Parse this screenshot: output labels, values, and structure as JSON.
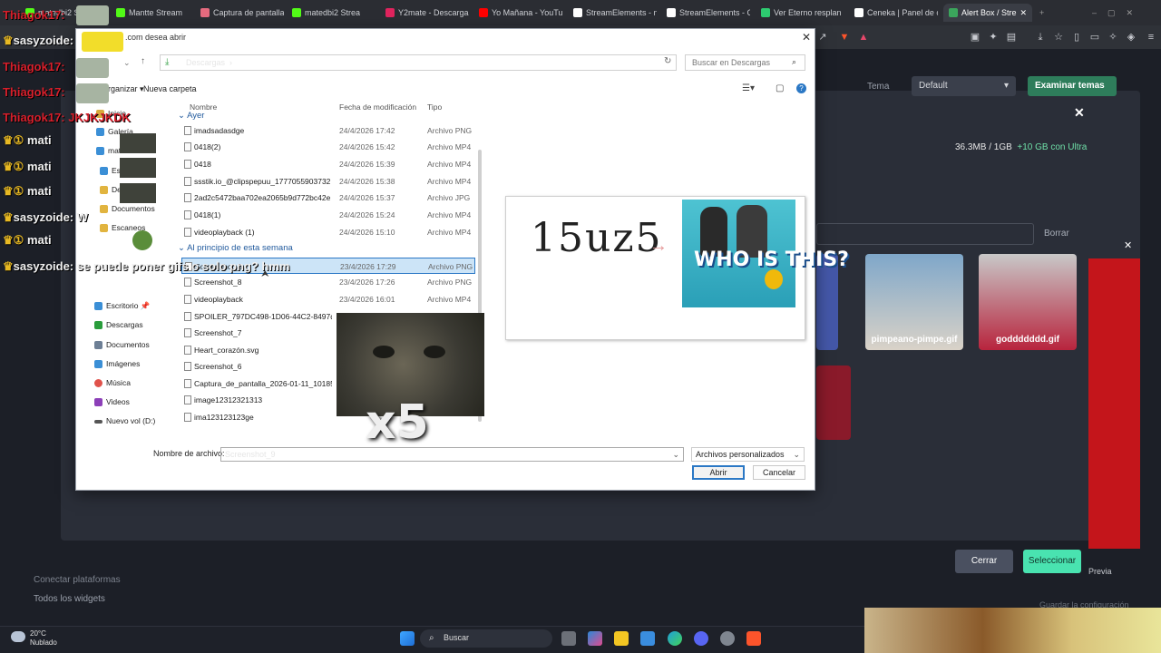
{
  "browser": {
    "tabs": [
      {
        "label": "matedbi2 Stream",
        "icon": "kick-icon",
        "color": "#53fc18"
      },
      {
        "label": "Mantte Stream",
        "icon": "kick-icon",
        "color": "#53fc18"
      },
      {
        "label": "Captura de pantalla",
        "icon": "folder-icon",
        "color": "#e66b7f"
      },
      {
        "label": "matedbi2 Strea",
        "icon": "kick-icon",
        "color": "#53fc18"
      },
      {
        "label": "Y2mate - Descarga",
        "icon": "y2mate-icon",
        "color": "#e0245e"
      },
      {
        "label": "Yo Mañana - YouTu",
        "icon": "youtube-icon",
        "color": "#ff0000"
      },
      {
        "label": "StreamElements - n",
        "icon": "streamelements-icon",
        "color": "#ffffff"
      },
      {
        "label": "StreamElements - C",
        "icon": "streamelements-icon",
        "color": "#ffffff"
      },
      {
        "label": "Ver Eterno resplan",
        "icon": "leaf-icon",
        "color": "#2ecc71"
      },
      {
        "label": "Ceneka | Panel de c",
        "icon": "google-icon",
        "color": "#ffffff"
      },
      {
        "label": "Alert Box / Stre",
        "icon": "streamelements-icon",
        "color": "#3ba55c"
      }
    ]
  },
  "app": {
    "tema_label": "Tema",
    "tema_value": "Default",
    "examinar_label": "Examinar temas",
    "storage_used": "36.3MB / 1GB",
    "storage_upgrade": "+10 GB con Ultra",
    "borrar_label": "Borrar",
    "thumbs": [
      {
        "label": "pimpeano-pimpe.gif"
      },
      {
        "label": "goddddddd.gif"
      }
    ],
    "cerrar_label": "Cerrar",
    "seleccionar_label": "Seleccionar",
    "previa_label": "Previa",
    "guardar_label": "Guardar la configuración",
    "conectar_label": "Conectar plataformas",
    "todos_label": "Todos los widgets"
  },
  "chat": [
    {
      "user": "Thiagok17:",
      "color": "red"
    },
    {
      "user": "sasyzoide:",
      "color": "white"
    },
    {
      "user": "Thiagok17:",
      "color": "red"
    },
    {
      "user": "Thiagok17:",
      "color": "red"
    },
    {
      "user": "Thiagok17: JKJKJKDK",
      "color": "red"
    },
    {
      "user": "mati",
      "color": "white"
    },
    {
      "user": "mati",
      "color": "white"
    },
    {
      "user": "mati",
      "color": "white"
    },
    {
      "user": "sasyzoide: W",
      "color": "white"
    },
    {
      "user": "mati",
      "color": "white"
    },
    {
      "user": "sasyzoide: se puede poner gifs o solo png? hmm",
      "color": "white"
    }
  ],
  "dialog": {
    "title": ".com desea abrir",
    "path": "Descargas",
    "search_placeholder": "Buscar en Descargas",
    "organize": "Organizar",
    "new_folder": "Nueva carpeta",
    "nav_items": [
      "Inicio",
      "Galería",
      "matias",
      "Escritorio",
      "Descargas",
      "Documentos",
      "Escaneos",
      "Escritorio",
      "Descargas",
      "Documentos",
      "Imágenes",
      "Música",
      "Videos",
      "Nuevo vol (D:)"
    ],
    "col_name": "Nombre",
    "col_date": "Fecha de modificación",
    "col_type": "Tipo",
    "group_yesterday": "Ayer",
    "group_week": "Al principio de esta semana",
    "files": [
      {
        "name": "imadsadasdge",
        "date": "24/4/2026 17:42",
        "type": "Archivo PNG"
      },
      {
        "name": "0418(2)",
        "date": "24/4/2026 15:42",
        "type": "Archivo MP4"
      },
      {
        "name": "0418",
        "date": "24/4/2026 15:39",
        "type": "Archivo MP4"
      },
      {
        "name": "ssstik.io_@clipspepuu_1777055903732",
        "date": "24/4/2026 15:38",
        "type": "Archivo MP4"
      },
      {
        "name": "2ad2c5472baa702ea2065b9d772bc42e",
        "date": "24/4/2026 15:37",
        "type": "Archivo JPG"
      },
      {
        "name": "0418(1)",
        "date": "24/4/2026 15:24",
        "type": "Archivo MP4"
      },
      {
        "name": "videoplayback (1)",
        "date": "24/4/2026 15:10",
        "type": "Archivo MP4"
      },
      {
        "name": "Screenshot_9",
        "date": "23/4/2026 17:29",
        "type": "Archivo PNG"
      },
      {
        "name": "Screenshot_8",
        "date": "23/4/2026 17:26",
        "type": "Archivo PNG"
      },
      {
        "name": "videoplayback",
        "date": "23/4/2026 16:01",
        "type": "Archivo MP4"
      },
      {
        "name": "SPOILER_797DC498-1D06-44C2-8497dasd...",
        "date": "",
        "type": ""
      },
      {
        "name": "Screenshot_7",
        "date": "",
        "type": ""
      },
      {
        "name": "Heart_corazón.svg",
        "date": "",
        "type": ""
      },
      {
        "name": "Screenshot_6",
        "date": "",
        "type": ""
      },
      {
        "name": "Captura_de_pantalla_2026-01-11_101853",
        "date": "",
        "type": ""
      },
      {
        "name": "image12312321313",
        "date": "",
        "type": ""
      },
      {
        "name": "ima123123123ge",
        "date": "",
        "type": ""
      }
    ],
    "preview_text": "15uz5",
    "preview_image_text": "WHO IS THIS?",
    "overlay_text": "x5",
    "filename_label": "Nombre de archivo:",
    "filename_value": "Screenshot_9",
    "filter_value": "Archivos personalizados",
    "open_label": "Abrir",
    "cancel_label": "Cancelar"
  },
  "taskbar": {
    "temperature": "20°C",
    "weather": "Nublado",
    "search_label": "Buscar"
  }
}
